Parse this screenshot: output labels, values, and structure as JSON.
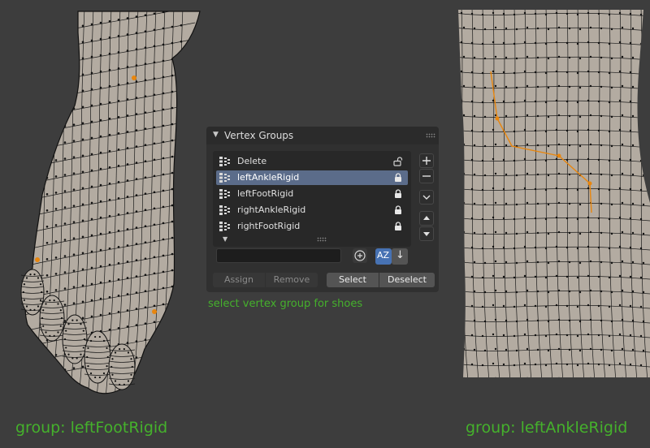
{
  "panel": {
    "title": "Vertex Groups",
    "groups": [
      {
        "name": "Delete",
        "locked": false,
        "active": false
      },
      {
        "name": "leftAnkleRigid",
        "locked": true,
        "active": true
      },
      {
        "name": "leftFootRigid",
        "locked": true,
        "active": false
      },
      {
        "name": "rightAnkleRigid",
        "locked": true,
        "active": false
      },
      {
        "name": "rightFootRigid",
        "locked": true,
        "active": false
      }
    ],
    "filter": {
      "value": "",
      "placeholder": ""
    },
    "buttons": {
      "assign": "Assign",
      "remove": "Remove",
      "select": "Select",
      "deselect": "Deselect"
    },
    "sort": {
      "alpha_label": "AZ",
      "order_glyph": "↓"
    }
  },
  "annotations": {
    "note": "select vertex group for shoes",
    "left_caption": "group: leftFootRigid",
    "right_caption": "group: leftAnkleRigid"
  },
  "colors": {
    "background": "#3d3d3d",
    "mesh_surface": "#b3aba1",
    "wire": "#111111",
    "selected_vertex": "#e8860e",
    "active_row": "#5b6c8a",
    "caption_green": "#45b12c",
    "accent_blue": "#4772b3"
  },
  "icons": {
    "group_icon": "vertex-group-icon",
    "lock": "lock-icon",
    "unlock": "unlock-icon",
    "add": "plus-icon",
    "remove": "minus-icon",
    "menu": "chevron-down-icon",
    "move_up": "arrow-up-icon",
    "move_down": "arrow-down-icon",
    "filter_toggle": "filter-plus-icon"
  }
}
